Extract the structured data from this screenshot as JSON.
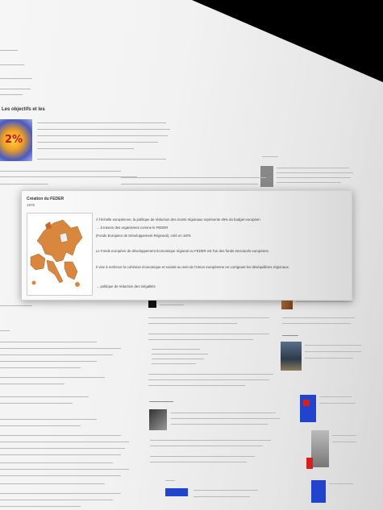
{
  "page": {
    "section_heading": "Objectifs",
    "left_heading": "Les objectifs et les",
    "graphic_label": "2%"
  },
  "popup": {
    "title": "Création du FEDER",
    "year": "1975",
    "line1": "À l'échelle européenne, la politique de réduction des écarts régionaux représente 45% du budget européen",
    "line2": "→ à travers des organismes comme le FEDER",
    "line3": "(Fonds Européen de Développement Régional), créé en 1975",
    "line4": "Le Fonds européen de développement économique régional ou FEDER est l'un des fonds structurels européens.",
    "line5": "Il vise à renforcer la cohésion économique et sociale au sein de l'Union européenne en corrigeant les déséquilibres régionaux.",
    "line6": "→ politique de réduction des inégalités"
  },
  "colors": {
    "map_regions": "#d9873f",
    "map_highlight": "#c46a25",
    "flag_blue": "#2244cc",
    "flag_red": "#d62020"
  }
}
